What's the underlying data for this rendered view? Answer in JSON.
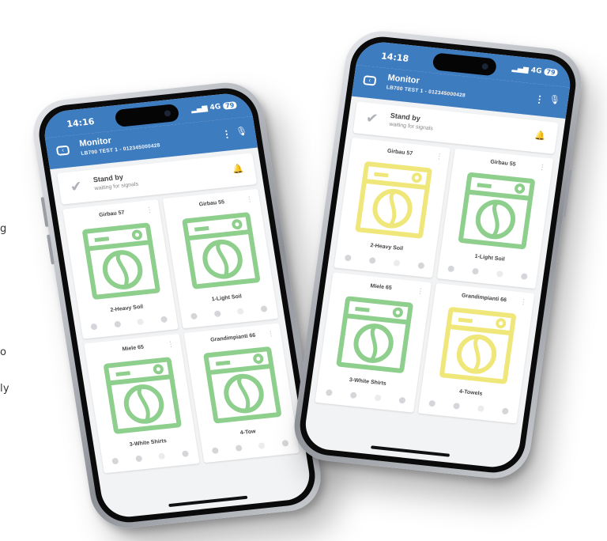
{
  "side_text": [
    "g",
    "o",
    "ly"
  ],
  "colors": {
    "brand": "#3e7cc0",
    "machine_green": "#8ecf8e",
    "machine_yellow": "#f0e77a"
  },
  "phone_back": {
    "status_time": "14:16",
    "status_right": "4G",
    "battery": "79",
    "app_title": "Monitor",
    "app_subtitle": "LB700 TEST 1 - 012345000428",
    "standby_title": "Stand by",
    "standby_subtitle": "waiting for signals",
    "machines": [
      {
        "name": "Girbau 57",
        "program": "2-Heavy Soil",
        "color": "green",
        "icon": "washing-machine-icon"
      },
      {
        "name": "Girbau 55",
        "program": "1-Light Soil",
        "color": "green",
        "icon": "washing-machine-icon"
      },
      {
        "name": "Miele 65",
        "program": "3-White Shirts",
        "color": "green",
        "icon": "washing-machine-icon"
      },
      {
        "name": "Grandimpianti 66",
        "program": "4-Tow",
        "color": "green",
        "icon": "washing-machine-icon"
      }
    ]
  },
  "phone_front": {
    "status_time": "14:18",
    "status_right": "4G",
    "battery": "79",
    "app_title": "Monitor",
    "app_subtitle": "LB700 TEST 1 - 012345000428",
    "standby_title": "Stand by",
    "standby_subtitle": "waiting for signals",
    "machines": [
      {
        "name": "Girbau 57",
        "program": "2-Heavy Soil",
        "color": "yellow",
        "icon": "washing-machine-icon"
      },
      {
        "name": "Girbau 55",
        "program": "1-Light Soil",
        "color": "green",
        "icon": "washing-machine-icon"
      },
      {
        "name": "Miele 65",
        "program": "3-White Shirts",
        "color": "green",
        "icon": "washing-machine-icon"
      },
      {
        "name": "Grandimpianti 66",
        "program": "4-Towels",
        "color": "yellow",
        "icon": "washing-machine-icon"
      }
    ]
  }
}
